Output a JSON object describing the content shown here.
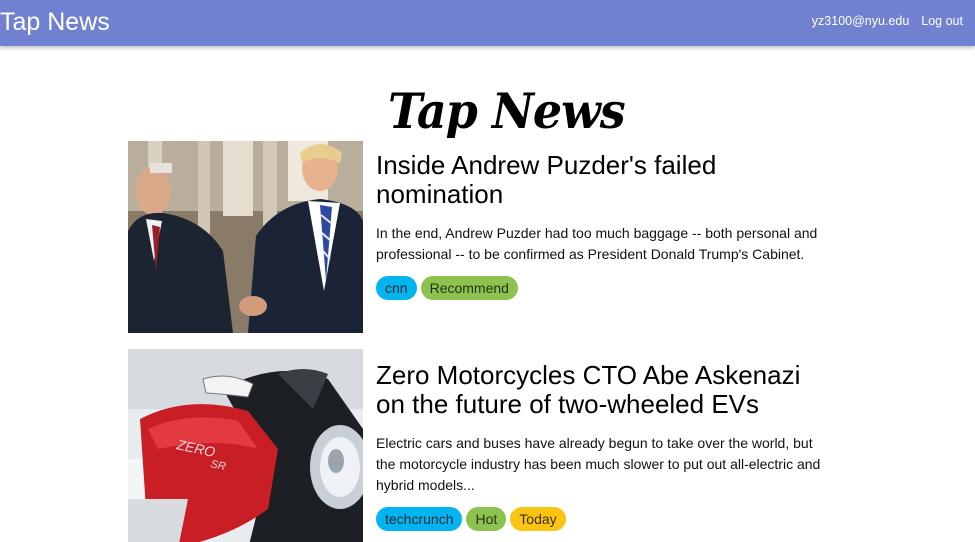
{
  "navbar": {
    "brand": "Tap News",
    "user_email": "yz3100@nyu.edu",
    "logout_label": "Log out",
    "background": "#7082cf"
  },
  "logo": {
    "text": "Tap News"
  },
  "news": [
    {
      "title": "Inside Andrew Puzder's failed nomination",
      "description": "In the end, Andrew Puzder had too much baggage -- both personal and professional -- to be confirmed as President Donald Trump's Cabinet.",
      "tags": [
        {
          "label": "cnn",
          "color": "#04b4ee"
        },
        {
          "label": "Recommend",
          "color": "#8ec24f"
        }
      ]
    },
    {
      "title": "Zero Motorcycles CTO Abe Askenazi on the future of two-wheeled EVs",
      "description": "Electric cars and buses have already begun to take over the world, but the motorcycle industry has been much slower to put out all-electric and hybrid models...",
      "tags": [
        {
          "label": "techcrunch",
          "color": "#04b4ee"
        },
        {
          "label": "Hot",
          "color": "#8ec24f"
        },
        {
          "label": "Today",
          "color": "#f9c512"
        }
      ]
    }
  ]
}
